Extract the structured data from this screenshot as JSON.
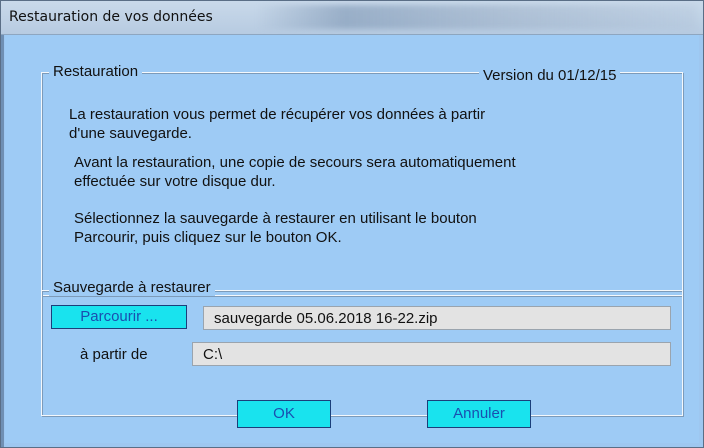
{
  "window": {
    "title": "Restauration de vos données"
  },
  "restore_group": {
    "label": "Restauration",
    "version": "Version du 01/12/15",
    "para1_line1": "La restauration vous permet de récupérer vos données à partir",
    "para1_line2": "d'une sauvegarde.",
    "para2_line1": "Avant la restauration, une copie de secours sera automatiquement",
    "para2_line2": "effectuée sur votre disque dur.",
    "para3_line1": "Sélectionnez la sauvegarde à restaurer en utilisant le bouton",
    "para3_line2": "Parcourir, puis cliquez sur le bouton OK."
  },
  "backup_group": {
    "label": "Sauvegarde à restaurer",
    "browse_label": "Parcourir ...",
    "file_value": "sauvegarde 05.06.2018 16-22.zip",
    "from_label": "à partir de",
    "from_value": "C:\\"
  },
  "buttons": {
    "ok_label": "OK",
    "cancel_label": "Annuler"
  },
  "colors": {
    "dialog_background": "#9ecbf5",
    "button_background": "#19e3ee",
    "button_text": "#1a4fb0"
  }
}
